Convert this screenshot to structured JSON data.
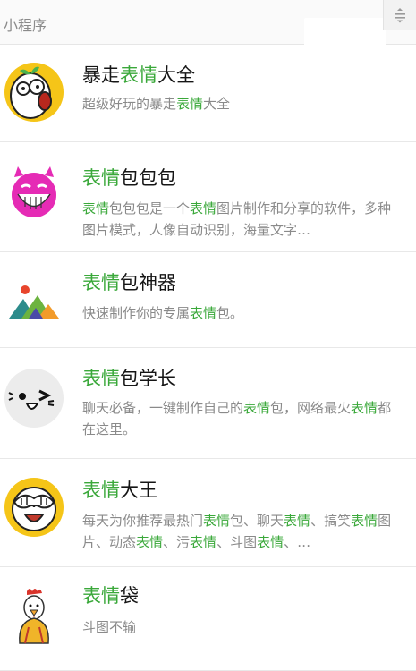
{
  "header": {
    "title": "小程序"
  },
  "colors": {
    "highlight": "#3aa83a",
    "title": "#151515",
    "desc": "#8a8a8a"
  },
  "items": [
    {
      "icon": "shocked-face-icon",
      "title": [
        {
          "t": "暴走"
        },
        {
          "t": "表情",
          "hl": true
        },
        {
          "t": "大全"
        }
      ],
      "desc": [
        {
          "t": "超级好玩的暴走"
        },
        {
          "t": "表情",
          "hl": true
        },
        {
          "t": "大全"
        }
      ]
    },
    {
      "icon": "pink-devil-face-icon",
      "title": [
        {
          "t": "表情",
          "hl": true
        },
        {
          "t": "包包包"
        }
      ],
      "desc": [
        {
          "t": "表情",
          "hl": true
        },
        {
          "t": "包包包是一个"
        },
        {
          "t": "表情",
          "hl": true
        },
        {
          "t": "图片制作和分享的软件，多种图片模式，人像自动识别，海量文字…"
        }
      ]
    },
    {
      "icon": "mountains-sun-icon",
      "title": [
        {
          "t": "表情",
          "hl": true
        },
        {
          "t": "包神器"
        }
      ],
      "desc": [
        {
          "t": "快速制作你的专属"
        },
        {
          "t": "表情",
          "hl": true
        },
        {
          "t": "包。"
        }
      ]
    },
    {
      "icon": "winking-face-icon",
      "title": [
        {
          "t": "表情",
          "hl": true
        },
        {
          "t": "包学长"
        }
      ],
      "desc": [
        {
          "t": "聊天必备，一键制作自己的"
        },
        {
          "t": "表情",
          "hl": true
        },
        {
          "t": "包，网络最火"
        },
        {
          "t": "表情",
          "hl": true
        },
        {
          "t": "都在这里。"
        }
      ]
    },
    {
      "icon": "face-palm-laugh-icon",
      "title": [
        {
          "t": "表情",
          "hl": true
        },
        {
          "t": "大王"
        }
      ],
      "desc": [
        {
          "t": "每天为你推荐最热门"
        },
        {
          "t": "表情",
          "hl": true
        },
        {
          "t": "包、聊天"
        },
        {
          "t": "表情",
          "hl": true
        },
        {
          "t": "、搞笑"
        },
        {
          "t": "表情",
          "hl": true
        },
        {
          "t": "图片、动态"
        },
        {
          "t": "表情",
          "hl": true
        },
        {
          "t": "、污"
        },
        {
          "t": "表情",
          "hl": true
        },
        {
          "t": "、斗图"
        },
        {
          "t": "表情",
          "hl": true
        },
        {
          "t": "、…"
        }
      ]
    },
    {
      "icon": "rooster-icon",
      "title": [
        {
          "t": "表情",
          "hl": true
        },
        {
          "t": "袋"
        }
      ],
      "desc": [
        {
          "t": "斗图不输"
        }
      ]
    }
  ]
}
